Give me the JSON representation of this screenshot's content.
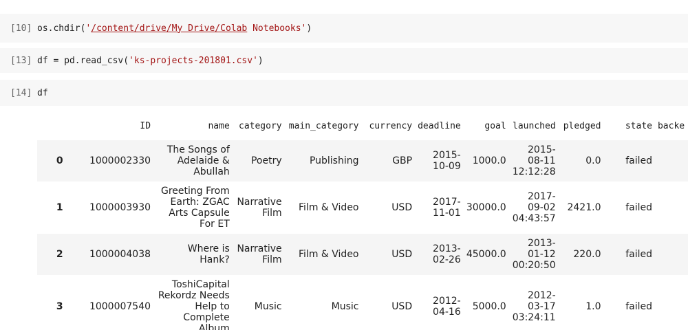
{
  "cells": [
    {
      "prompt": "[10]",
      "code_prefix": "os.chdir(",
      "string_quote_open": "'",
      "string_path": "/content/drive/My Drive/Colab",
      "string_rest": " Notebooks",
      "string_quote_close": "'",
      "code_suffix": ")"
    },
    {
      "prompt": "[13]",
      "code_prefix": "df = pd.read_csv(",
      "string_value": "'ks-projects-201801.csv'",
      "code_suffix": ")"
    },
    {
      "prompt": "[14]",
      "code": "df"
    }
  ],
  "dataframe": {
    "columns": [
      "",
      "ID",
      "name",
      "category",
      "main_category",
      "currency",
      "deadline",
      "goal",
      "launched",
      "pledged",
      "state",
      "backe"
    ],
    "rows": [
      {
        "index": "0",
        "id": "1000002330",
        "name": [
          "The Songs of",
          "Adelaide &",
          "Abullah"
        ],
        "category": [
          "Poetry"
        ],
        "main_category": "Publishing",
        "currency": "GBP",
        "deadline": [
          "2015-",
          "10-09"
        ],
        "goal": "1000.0",
        "launched": [
          "2015-",
          "08-11",
          "12:12:28"
        ],
        "pledged": "0.0",
        "state": "failed"
      },
      {
        "index": "1",
        "id": "1000003930",
        "name": [
          "Greeting From",
          "Earth: ZGAC",
          "Arts Capsule",
          "For ET"
        ],
        "category": [
          "Narrative",
          "Film"
        ],
        "main_category": "Film & Video",
        "currency": "USD",
        "deadline": [
          "2017-",
          "11-01"
        ],
        "goal": "30000.0",
        "launched": [
          "2017-",
          "09-02",
          "04:43:57"
        ],
        "pledged": "2421.0",
        "state": "failed"
      },
      {
        "index": "2",
        "id": "1000004038",
        "name": [
          "Where is",
          "Hank?"
        ],
        "category": [
          "Narrative",
          "Film"
        ],
        "main_category": "Film & Video",
        "currency": "USD",
        "deadline": [
          "2013-",
          "02-26"
        ],
        "goal": "45000.0",
        "launched": [
          "2013-",
          "01-12",
          "00:20:50"
        ],
        "pledged": "220.0",
        "state": "failed"
      },
      {
        "index": "3",
        "id": "1000007540",
        "name": [
          "ToshiCapital",
          "Rekordz Needs",
          "Help to",
          "Complete",
          "Album"
        ],
        "category": [
          "Music"
        ],
        "main_category": "Music",
        "currency": "USD",
        "deadline": [
          "2012-",
          "04-16"
        ],
        "goal": "5000.0",
        "launched": [
          "2012-",
          "03-17",
          "03:24:11"
        ],
        "pledged": "1.0",
        "state": "failed"
      }
    ]
  }
}
